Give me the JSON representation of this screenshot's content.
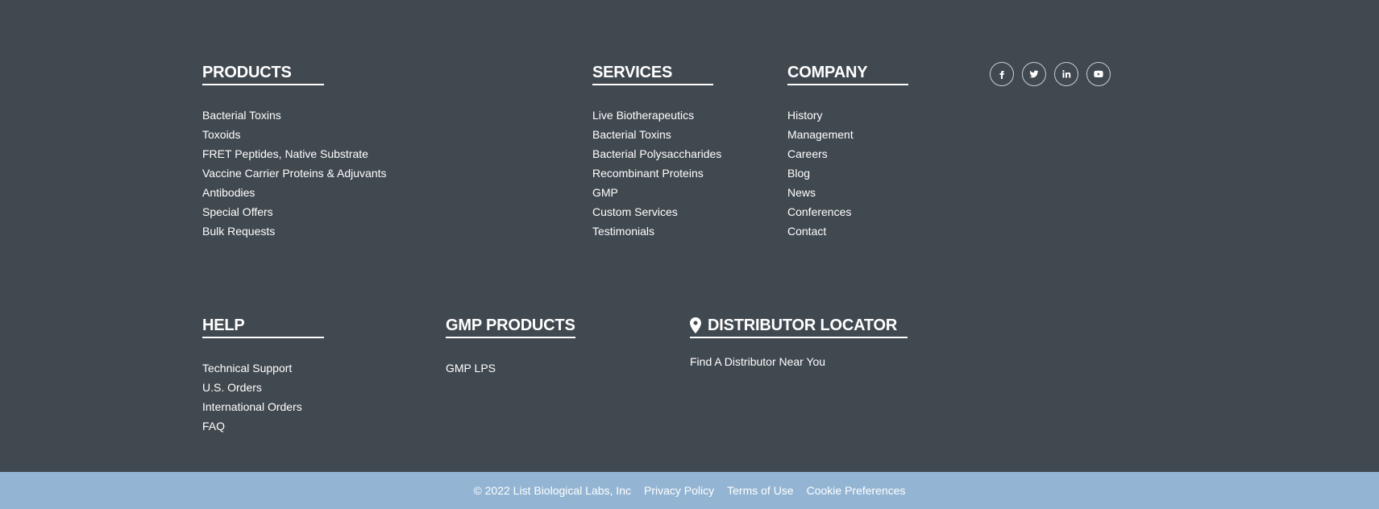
{
  "products": {
    "heading": "PRODUCTS",
    "items": [
      "Bacterial Toxins",
      "Toxoids",
      "FRET Peptides, Native Substrate",
      "Vaccine Carrier Proteins & Adjuvants",
      "Antibodies",
      "Special Offers",
      "Bulk Requests"
    ]
  },
  "services": {
    "heading": "SERVICES",
    "items": [
      "Live Biotherapeutics",
      "Bacterial Toxins",
      "Bacterial Polysaccharides",
      "Recombinant Proteins",
      "GMP",
      "Custom Services",
      "Testimonials"
    ]
  },
  "company": {
    "heading": "COMPANY",
    "items": [
      "History",
      "Management",
      "Careers",
      "Blog",
      "News",
      "Conferences",
      "Contact"
    ]
  },
  "social": {
    "icons": [
      "facebook-icon",
      "twitter-icon",
      "linkedin-icon",
      "youtube-icon"
    ]
  },
  "help": {
    "heading": "HELP",
    "items": [
      "Technical Support",
      "U.S. Orders",
      "International Orders",
      "FAQ"
    ]
  },
  "gmp_products": {
    "heading": "GMP PRODUCTS",
    "items": [
      "GMP LPS"
    ]
  },
  "distributor": {
    "heading": "DISTRIBUTOR LOCATOR",
    "link": "Find A Distributor Near You",
    "icon": "map-pin-icon"
  },
  "bottom_bar": {
    "copyright": "© 2022 List Biological Labs, Inc",
    "privacy": "Privacy Policy",
    "terms": "Terms of Use",
    "cookies": "Cookie Preferences"
  },
  "colors": {
    "background": "#414950",
    "bottom_bar": "#93b5d3",
    "text": "#ffffff"
  }
}
